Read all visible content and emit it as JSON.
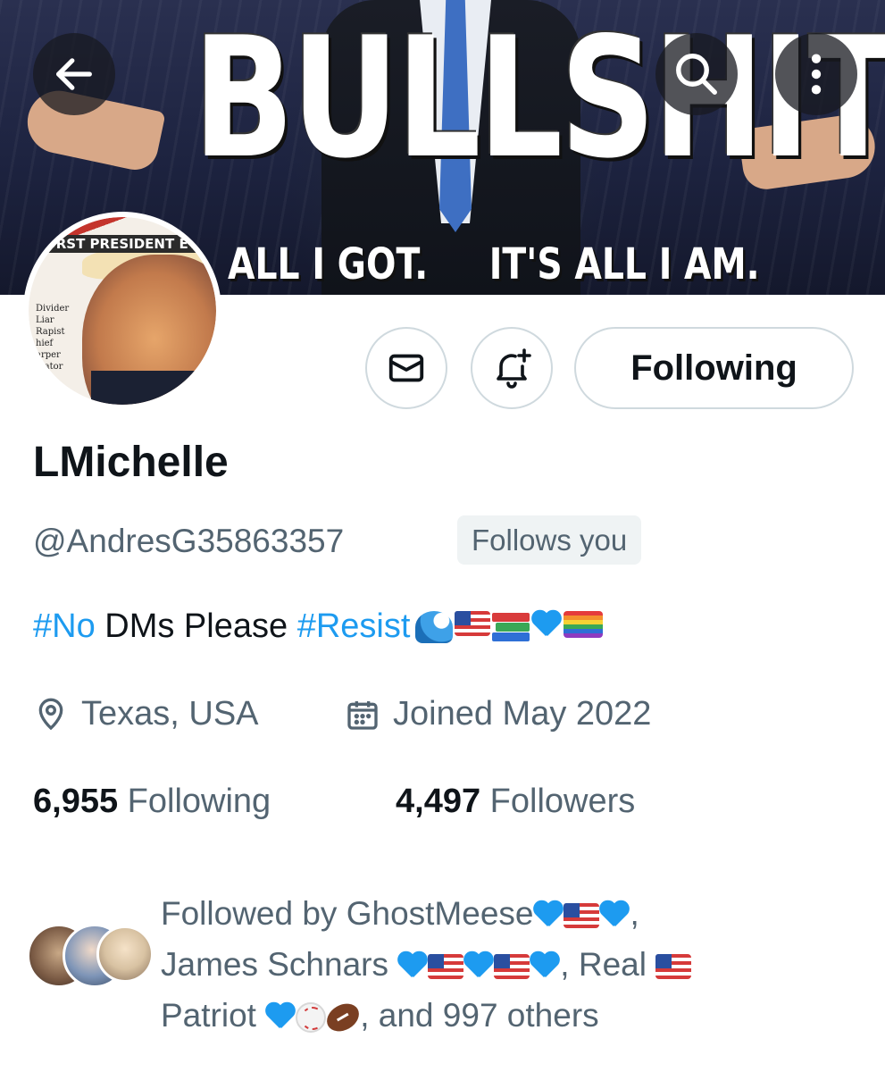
{
  "banner": {
    "headline": "BULLSHIT",
    "subline": "ALL I GOT.     IT'S ALL I AM."
  },
  "toolbar": {
    "back_icon": "arrow-left-icon",
    "search_icon": "search-icon",
    "more_icon": "more-vertical-icon"
  },
  "avatar": {
    "cover_title": "ORST PRESIDENT EVE",
    "cover_words": [
      "Divider",
      "Liar",
      "Rapist",
      "hief",
      "arper",
      "ulator"
    ]
  },
  "actions": {
    "message_icon": "mail-icon",
    "notify_icon": "bell-plus-icon",
    "follow_label": "Following"
  },
  "profile": {
    "name": "LMichelle",
    "handle": "@AndresG35863357",
    "follows_you": "Follows you",
    "bio": {
      "tag1": "#No",
      "text": " DMs Please ",
      "tag2": "#Resist"
    },
    "location": "Texas, USA",
    "joined": "Joined May 2022"
  },
  "stats": {
    "following_count": "6,955",
    "following_label": "Following",
    "followers_count": "4,497",
    "followers_label": "Followers"
  },
  "followed_by": {
    "prefix": "Followed by GhostMeese",
    "name2": "James Schnars ",
    "name3": "Real ",
    "name3b": "Patriot ",
    "suffix": ", and 997 others"
  },
  "colors": {
    "accent": "#1d9bf0",
    "secondary_text": "#536471",
    "primary_text": "#0f1419",
    "border": "#cfd9de"
  }
}
